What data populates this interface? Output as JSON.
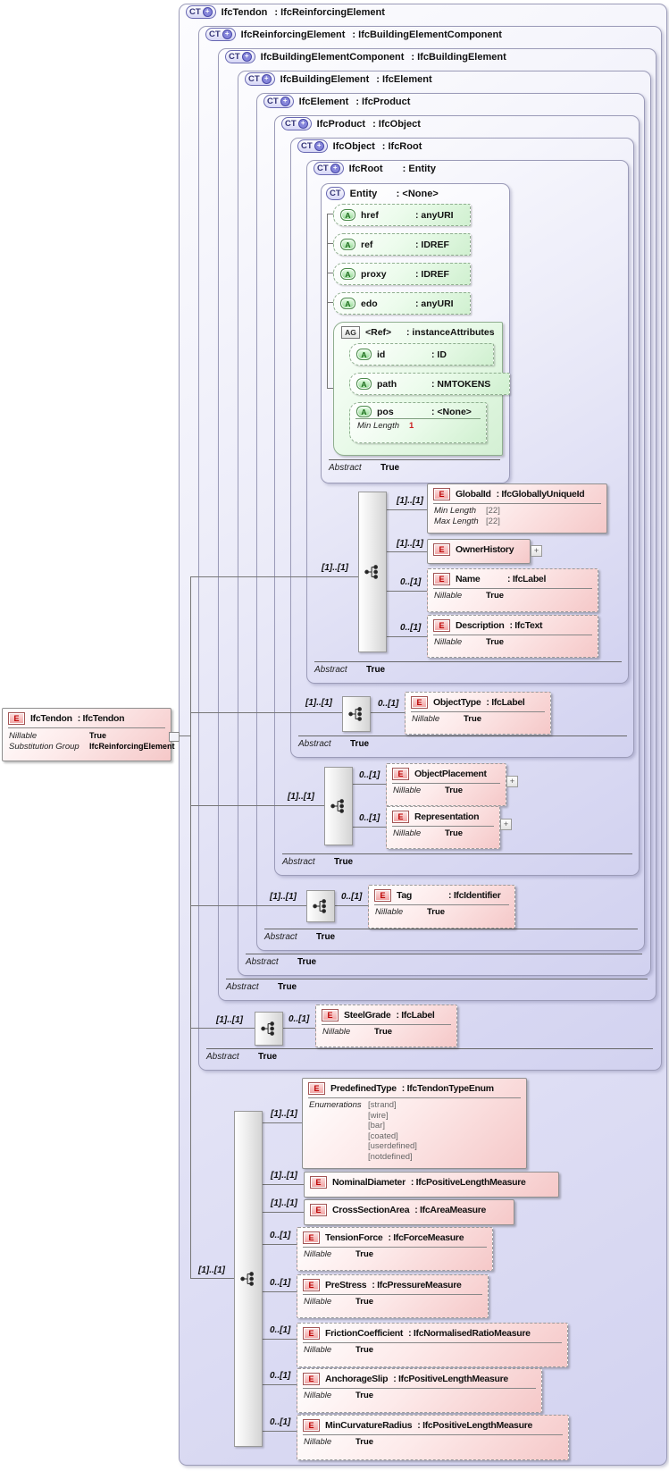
{
  "icons": {
    "ct": "CT",
    "e": "E",
    "a": "A",
    "ag": "AG",
    "plus": "+"
  },
  "abstract": {
    "label": "Abstract",
    "value": "True"
  },
  "containers": [
    {
      "name": "IfcTendon",
      "type": ": IfcReinforcingElement"
    },
    {
      "name": "IfcReinforcingElement",
      "type": ": IfcBuildingElementComponent"
    },
    {
      "name": "IfcBuildingElementComponent",
      "type": ": IfcBuildingElement"
    },
    {
      "name": "IfcBuildingElement",
      "type": ": IfcElement"
    },
    {
      "name": "IfcElement",
      "type": ": IfcProduct"
    },
    {
      "name": "IfcProduct",
      "type": ": IfcObject"
    },
    {
      "name": "IfcObject",
      "type": ": IfcRoot"
    },
    {
      "name": "IfcRoot",
      "type": ": Entity"
    }
  ],
  "entity": {
    "name": "Entity",
    "type": ": <None>",
    "attributes": [
      {
        "name": "href",
        "type": ": anyURI"
      },
      {
        "name": "ref",
        "type": ": IDREF"
      },
      {
        "name": "proxy",
        "type": ": IDREF"
      },
      {
        "name": "edo",
        "type": ": anyURI"
      }
    ],
    "group": {
      "name": "<Ref>",
      "type": ": instanceAttributes",
      "attributes": [
        {
          "name": "id",
          "type": ": ID"
        },
        {
          "name": "path",
          "type": ": NMTOKENS"
        },
        {
          "name": "pos",
          "type": ": <None>",
          "facet": {
            "label": "Min Length",
            "value": "1"
          }
        }
      ]
    }
  },
  "main": {
    "name": "IfcTendon",
    "type": ": IfcTendon",
    "facets": [
      {
        "label": "Nillable",
        "value": "True"
      },
      {
        "label": "Substitution Group",
        "value": "IfcReinforcingElement"
      }
    ]
  },
  "seq": {
    "root": "[1]..[1]",
    "object": "[1]..[1]",
    "product": "[1]..[1]",
    "element": "[1]..[1]",
    "reinforcing": "[1]..[1]",
    "tendon": "[1]..[1]"
  },
  "elements": {
    "root": [
      {
        "card": "[1]..[1]",
        "name": "GlobalId",
        "type": ": IfcGloballyUniqueId",
        "facets": [
          {
            "label": "Min Length",
            "value": "[22]"
          },
          {
            "label": "Max Length",
            "value": "[22]"
          }
        ]
      },
      {
        "card": "[1]..[1]",
        "name": "OwnerHistory",
        "type": ""
      },
      {
        "card": "0..[1]",
        "name": "Name",
        "type": ": IfcLabel",
        "facets": [
          {
            "label": "Nillable",
            "value": "True"
          }
        ]
      },
      {
        "card": "0..[1]",
        "name": "Description",
        "type": ": IfcText",
        "facets": [
          {
            "label": "Nillable",
            "value": "True"
          }
        ]
      }
    ],
    "object": [
      {
        "card": "0..[1]",
        "name": "ObjectType",
        "type": ": IfcLabel",
        "facets": [
          {
            "label": "Nillable",
            "value": "True"
          }
        ]
      }
    ],
    "product": [
      {
        "card": "0..[1]",
        "name": "ObjectPlacement",
        "type": "",
        "facets": [
          {
            "label": "Nillable",
            "value": "True"
          }
        ]
      },
      {
        "card": "0..[1]",
        "name": "Representation",
        "type": "",
        "facets": [
          {
            "label": "Nillable",
            "value": "True"
          }
        ]
      }
    ],
    "element": [
      {
        "card": "0..[1]",
        "name": "Tag",
        "type": ": IfcIdentifier",
        "facets": [
          {
            "label": "Nillable",
            "value": "True"
          }
        ]
      }
    ],
    "reinforcing": [
      {
        "card": "0..[1]",
        "name": "SteelGrade",
        "type": ": IfcLabel",
        "facets": [
          {
            "label": "Nillable",
            "value": "True"
          }
        ]
      }
    ],
    "tendon": [
      {
        "card": "[1]..[1]",
        "name": "PredefinedType",
        "type": ": IfcTendonTypeEnum",
        "enum_label": "Enumerations",
        "enums": [
          "[strand]",
          "[wire]",
          "[bar]",
          "[coated]",
          "[userdefined]",
          "[notdefined]"
        ]
      },
      {
        "card": "[1]..[1]",
        "name": "NominalDiameter",
        "type": ": IfcPositiveLengthMeasure"
      },
      {
        "card": "[1]..[1]",
        "name": "CrossSectionArea",
        "type": ": IfcAreaMeasure"
      },
      {
        "card": "0..[1]",
        "name": "TensionForce",
        "type": ": IfcForceMeasure",
        "facets": [
          {
            "label": "Nillable",
            "value": "True"
          }
        ]
      },
      {
        "card": "0..[1]",
        "name": "PreStress",
        "type": ": IfcPressureMeasure",
        "facets": [
          {
            "label": "Nillable",
            "value": "True"
          }
        ]
      },
      {
        "card": "0..[1]",
        "name": "FrictionCoefficient",
        "type": ": IfcNormalisedRatioMeasure",
        "facets": [
          {
            "label": "Nillable",
            "value": "True"
          }
        ]
      },
      {
        "card": "0..[1]",
        "name": "AnchorageSlip",
        "type": ": IfcPositiveLengthMeasure",
        "facets": [
          {
            "label": "Nillable",
            "value": "True"
          }
        ]
      },
      {
        "card": "0..[1]",
        "name": "MinCurvatureRadius",
        "type": ": IfcPositiveLengthMeasure",
        "facets": [
          {
            "label": "Nillable",
            "value": "True"
          }
        ]
      }
    ]
  }
}
